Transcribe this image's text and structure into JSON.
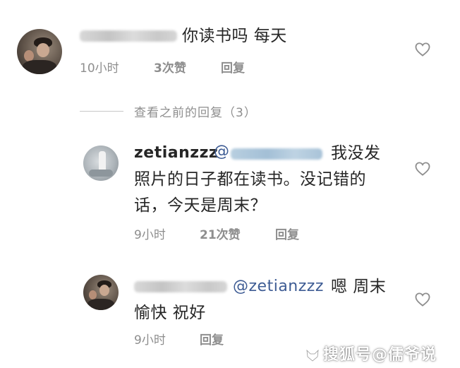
{
  "comment1": {
    "text": "你读书吗 每天",
    "time": "10小时",
    "likes": "3次赞",
    "reply": "回复"
  },
  "view_previous": "查看之前的回复（3）",
  "reply1": {
    "username": "zetianzzz",
    "line1": "我没发",
    "line2": "照片的日子都在读书。没记错的",
    "line3": "话，今天是周末？",
    "time": "9小时",
    "likes": "21次赞",
    "reply": "回复"
  },
  "reply2": {
    "mention": "@zetianzzz",
    "line1_rest": "嗯 周末",
    "line2": "愉快 祝好",
    "time": "9小时",
    "reply": "回复"
  },
  "watermark": "搜狐号@儒爷说",
  "colors": {
    "text": "#262626",
    "meta": "#8e8e8e",
    "mention": "#3e5c94",
    "background": "#ffffff"
  },
  "icons": [
    "heart-outline-icon",
    "sohu-fox-icon"
  ]
}
